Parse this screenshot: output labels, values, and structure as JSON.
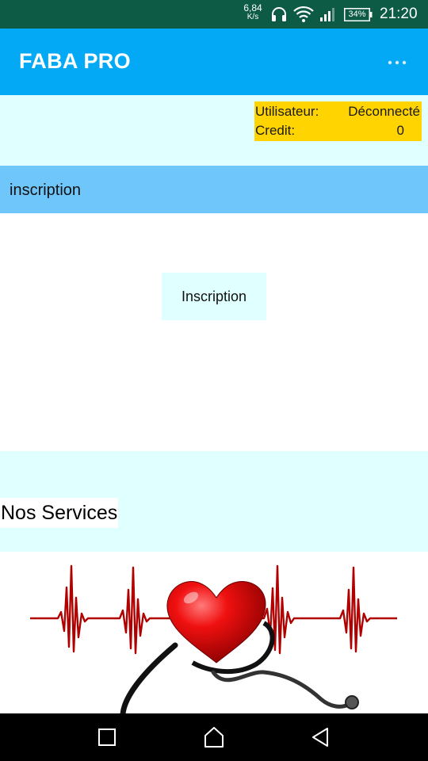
{
  "status_bar": {
    "net_speed": "6,84",
    "net_unit": "K/s",
    "battery": "34%",
    "time": "21:20"
  },
  "app_bar": {
    "title": "FABA PRO",
    "menu_icon": "more-horizontal-icon"
  },
  "user_info": {
    "user_label": "Utilisateur:",
    "user_value": "Déconnecté",
    "credit_label": "Credit:",
    "credit_value": "0"
  },
  "section_header": {
    "title": "inscription"
  },
  "register": {
    "button_label": "Inscription"
  },
  "services": {
    "title": "Nos Services",
    "image_icon": "heart-stethoscope-icon"
  },
  "nav_bar": {
    "back_icon": "back-triangle-icon",
    "home_icon": "home-icon",
    "recents_icon": "recents-square-icon"
  },
  "colors": {
    "status_bar": "#0d5a45",
    "app_bar": "#03a9f4",
    "light_cyan": "#e0ffff",
    "user_box": "#ffd400",
    "section_header": "#6ec6fa",
    "heart_red": "#d90000",
    "ecg_red": "#b00000"
  }
}
